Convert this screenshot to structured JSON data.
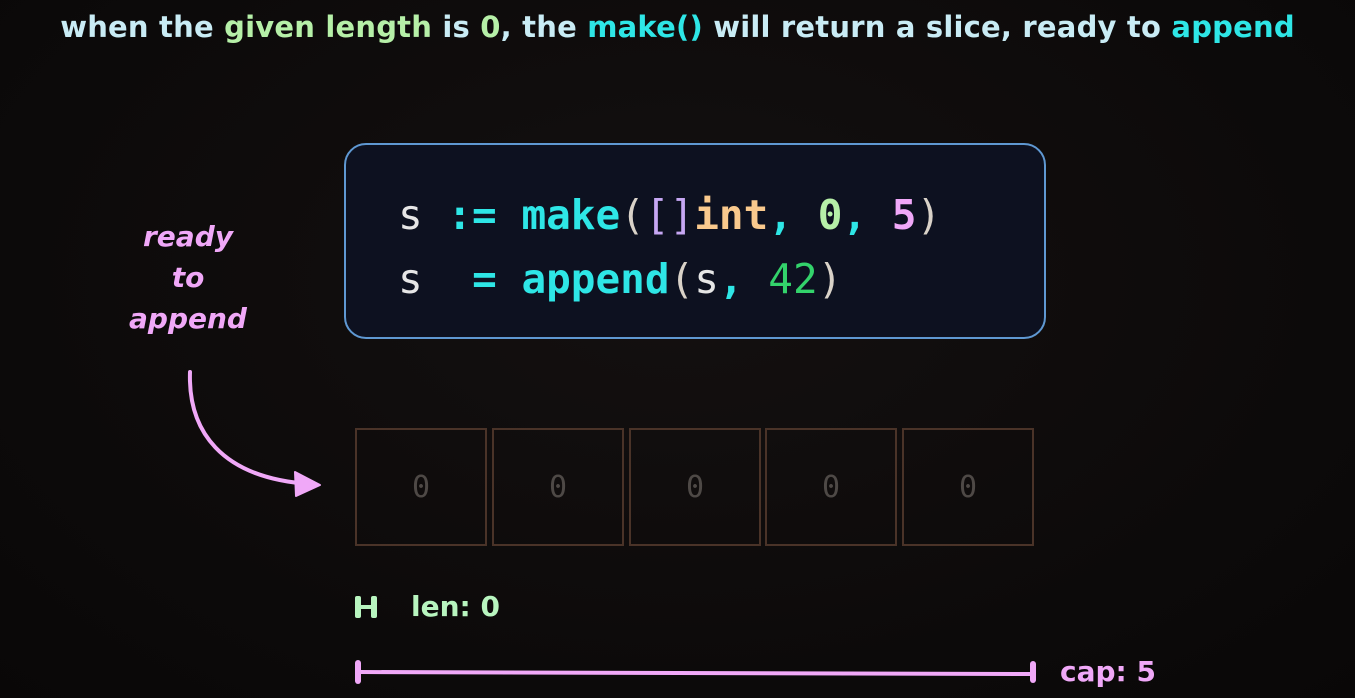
{
  "headline": {
    "p1": "when the ",
    "p2": "given length",
    "p3": " is ",
    "p4": "0",
    "p5": ", the ",
    "p6": "make()",
    "p7": " will return a slice, ready to ",
    "p8": "append"
  },
  "code": {
    "line1": {
      "var": "s",
      "op": ":=",
      "func": "make",
      "open_paren": "(",
      "brackets": "[]",
      "type": "int",
      "comma1": ",",
      "len": "0",
      "comma2": ",",
      "cap": "5",
      "close_paren": ")"
    },
    "line2": {
      "var": "s",
      "op": "=",
      "func": "append",
      "open_paren": "(",
      "arg": "s",
      "comma": ",",
      "value": "42",
      "close_paren": ")"
    }
  },
  "side_note": {
    "line1": "ready",
    "line2": "to",
    "line3": "append"
  },
  "cells": [
    "0",
    "0",
    "0",
    "0",
    "0"
  ],
  "len_label": "len:",
  "len_value": "0",
  "cap_label": "cap:",
  "cap_value": "5",
  "colors": {
    "background": "#0e0b0b",
    "text_light": "#c9ecf5",
    "green_soft": "#b6f0a8",
    "cyan": "#2ee6e6",
    "mint": "#8ff3d0",
    "peach": "#f9c98d",
    "lavender": "#c6a7f3",
    "pink": "#f0a8f8",
    "green_num": "#33d36b",
    "code_border": "#5f98d2",
    "code_bg": "#0d1120",
    "cell_border": "#4a3328"
  }
}
